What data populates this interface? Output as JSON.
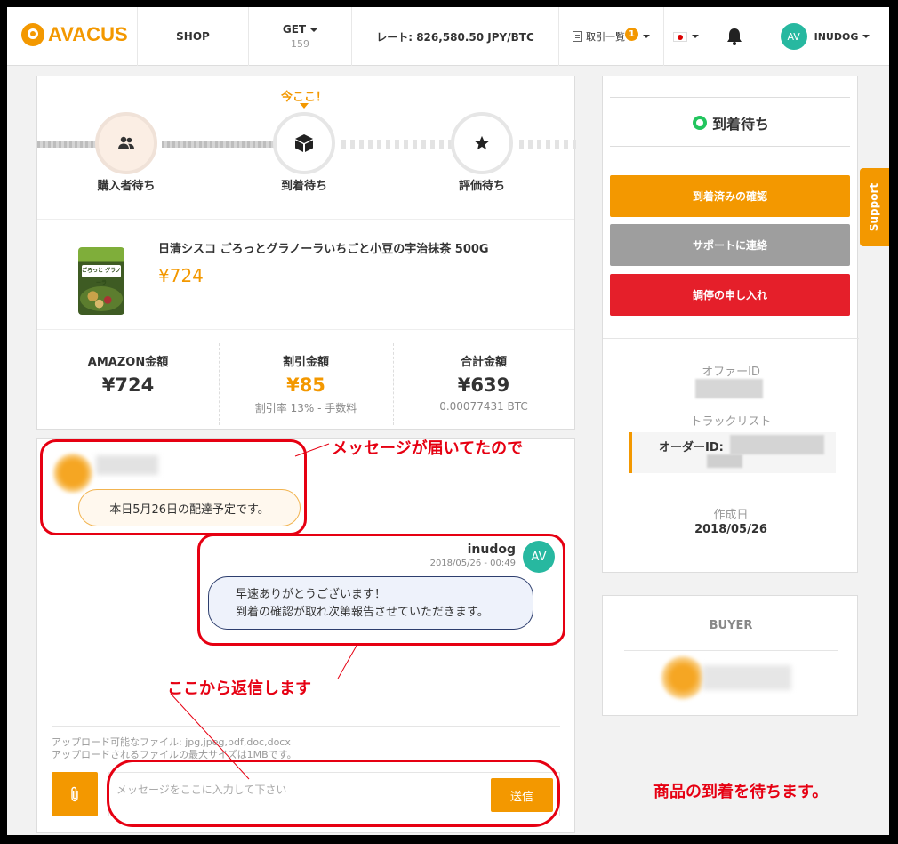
{
  "header": {
    "logo": "AVACUS",
    "shop": "SHOP",
    "get": "GET",
    "get_count": "159",
    "rate": "レート: 826,580.50 JPY/BTC",
    "trades": "取引一覧",
    "trades_badge": "1",
    "username": "INUDOG",
    "avatar_initials": "AV"
  },
  "stepper": {
    "current_marker": "今ここ！",
    "steps": [
      {
        "label": "購入者待ち",
        "icon": "users-icon"
      },
      {
        "label": "到着待ち",
        "icon": "box-icon"
      },
      {
        "label": "評価待ち",
        "icon": "star-icon"
      }
    ]
  },
  "product": {
    "title": "日清シスコ ごろっとグラノーラいちごと小豆の宇治抹茶 500G",
    "price": "¥724",
    "image_caption": "ごろっと グラノーラ"
  },
  "summary": {
    "amazon_label": "AMAZON金額",
    "amazon_value": "¥724",
    "discount_label": "割引金額",
    "discount_value": "¥85",
    "discount_note": "割引率 13% - 手数料",
    "total_label": "合計金額",
    "total_value": "¥639",
    "total_btc": "0.00077431 BTC"
  },
  "messages": {
    "received_text": "本日5月26日の配達予定です。",
    "sent_user": "inudog",
    "sent_time": "2018/05/26 - 00:49",
    "sent_line1": "早速ありがとうございます！",
    "sent_line2": "到着の確認が取れ次第報告させていただきます。",
    "sent_avatar": "AV"
  },
  "upload": {
    "line1": "アップロード可能なファイル: jpg,jpeg,pdf,doc,docx",
    "line2": "アップロードされるファイルの最大サイズは1MBです。"
  },
  "compose": {
    "placeholder": "メッセージをここに入力して下さい",
    "send": "送信"
  },
  "sidebar": {
    "status": "到着待ち",
    "confirm_button": "到着済みの確認",
    "support_button": "サポートに連絡",
    "dispute_button": "調停の申し入れ",
    "offer_id_label": "オファーID",
    "track_label": "トラックリスト",
    "order_id_label": "オーダーID:",
    "created_label": "作成日",
    "created_value": "2018/05/26",
    "buyer_label": "BUYER"
  },
  "support_tab": "Support",
  "annotations": {
    "a1": "メッセージが届いてたので",
    "a2": "ここから返信します",
    "a3": "商品の到着を待ちます。"
  },
  "colors": {
    "accent": "#f39800",
    "gray_button": "#9e9e9e",
    "red_button": "#e51f2a",
    "status_green": "#22c55e",
    "avatar": "#27b8a0",
    "annotation": "#e60012"
  }
}
